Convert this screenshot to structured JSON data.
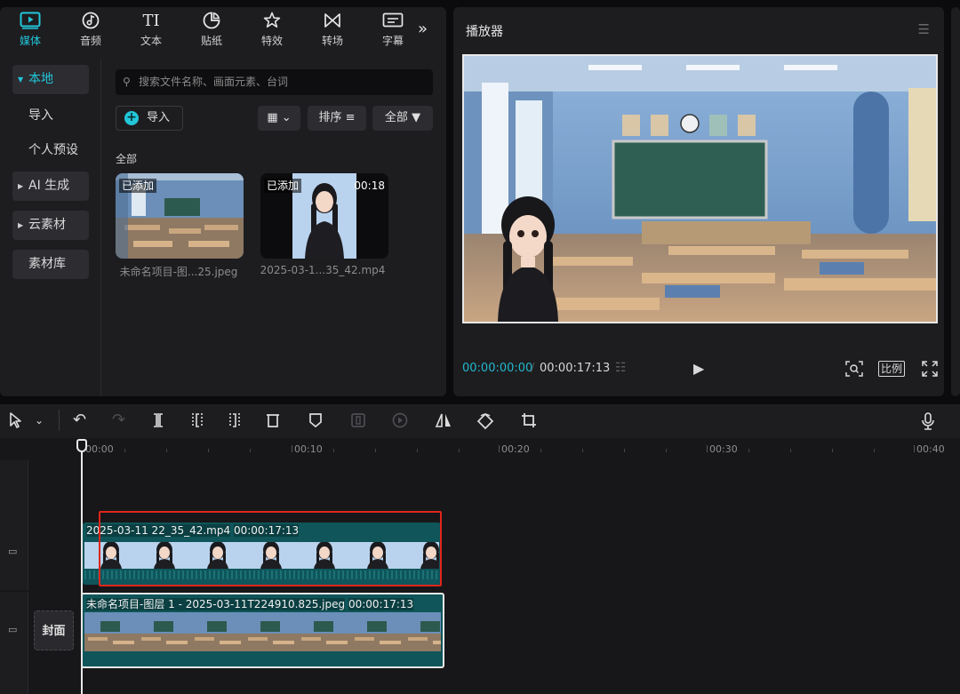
{
  "media_tabs": [
    {
      "label": "媒体",
      "icon": "media-icon",
      "glyph": "▶"
    },
    {
      "label": "音频",
      "icon": "music-icon",
      "glyph": "♪"
    },
    {
      "label": "文本",
      "icon": "text-icon",
      "glyph": "TI"
    },
    {
      "label": "贴纸",
      "icon": "sticker-icon",
      "glyph": "◔"
    },
    {
      "label": "特效",
      "icon": "effects-icon",
      "glyph": "☆"
    },
    {
      "label": "转场",
      "icon": "transition-icon",
      "glyph": "⋈"
    },
    {
      "label": "字幕",
      "icon": "subtitle-icon",
      "glyph": "⌨"
    }
  ],
  "sidebar": {
    "local": "本地",
    "import": "导入",
    "personal_preset": "个人预设",
    "ai_generate": "AI 生成",
    "cloud": "云素材",
    "library": "素材库"
  },
  "search": {
    "placeholder": "搜索文件名称、画面元素、台词"
  },
  "buttons": {
    "import": "导入",
    "sort": "排序",
    "all": "全部"
  },
  "group_label": "全部",
  "media_items": [
    {
      "badge": "已添加",
      "caption": "未命名项目-图...25.jpeg",
      "duration": ""
    },
    {
      "badge": "已添加",
      "caption": "2025-03-1...35_42.mp4",
      "duration": "00:18"
    }
  ],
  "player": {
    "title": "播放器",
    "current_time": "00:00:00:00",
    "total_time": "00:00:17:13",
    "ratio_label": "比例"
  },
  "ruler_labels": [
    "00:00",
    "00:10",
    "00:20",
    "00:30",
    "00:40"
  ],
  "clips": {
    "video": {
      "name": "2025-03-11 22_35_42.mp4",
      "duration": "00:00:17:13"
    },
    "image": {
      "name": "未命名项目-图层 1 - 2025-03-11T224910.825.jpeg",
      "duration": "00:00:17:13"
    }
  },
  "cover_label": "封面",
  "colors": {
    "accent": "#22c6d8",
    "clip": "#0f5559",
    "highlight_box": "#e0251b"
  }
}
